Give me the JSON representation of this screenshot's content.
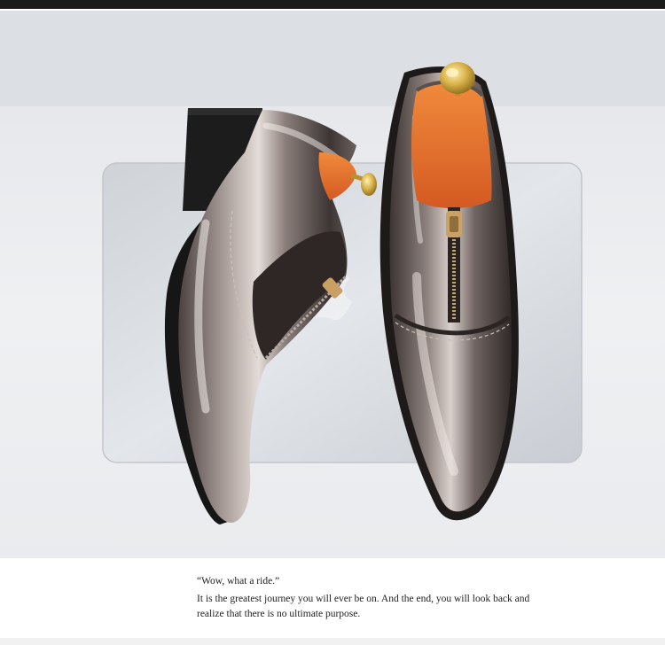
{
  "photo": {
    "subject": "pair of glossy metallic-silver pointed oxford shoes with front zippers, orange insoles and brass shoe-tree knobs, on a silver laptop",
    "colors": {
      "background": "#e7e9ec",
      "shoe_metal": "#7b6f6b",
      "insole": "#e06a2b",
      "brass": "#d9b24a",
      "laptop": "#d8dbe0"
    }
  },
  "caption": {
    "quote": "“Wow, what a ride.”",
    "line1": "It is the greatest journey you will ever be on. And the end, you will look back and",
    "line2": "realize that there is no ultimate purpose."
  }
}
